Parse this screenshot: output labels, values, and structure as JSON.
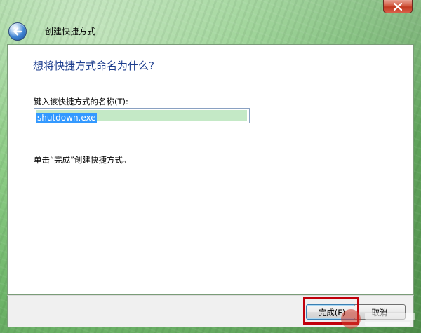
{
  "wizard": {
    "title": "创建快捷方式",
    "heading": "想将快捷方式命名为什么?",
    "name_label": "键入该快捷方式的名称(T):",
    "name_value": "shutdown.exe",
    "instruction": "单击“完成”创建快捷方式。"
  },
  "buttons": {
    "finish_label": "完成(F)",
    "cancel_label": "取消"
  },
  "icons": {
    "back": "back-arrow-icon",
    "close": "close-icon"
  },
  "colors": {
    "heading": "#1c3d8e",
    "highlight": "#c0000b",
    "selection": "#3399ff"
  }
}
